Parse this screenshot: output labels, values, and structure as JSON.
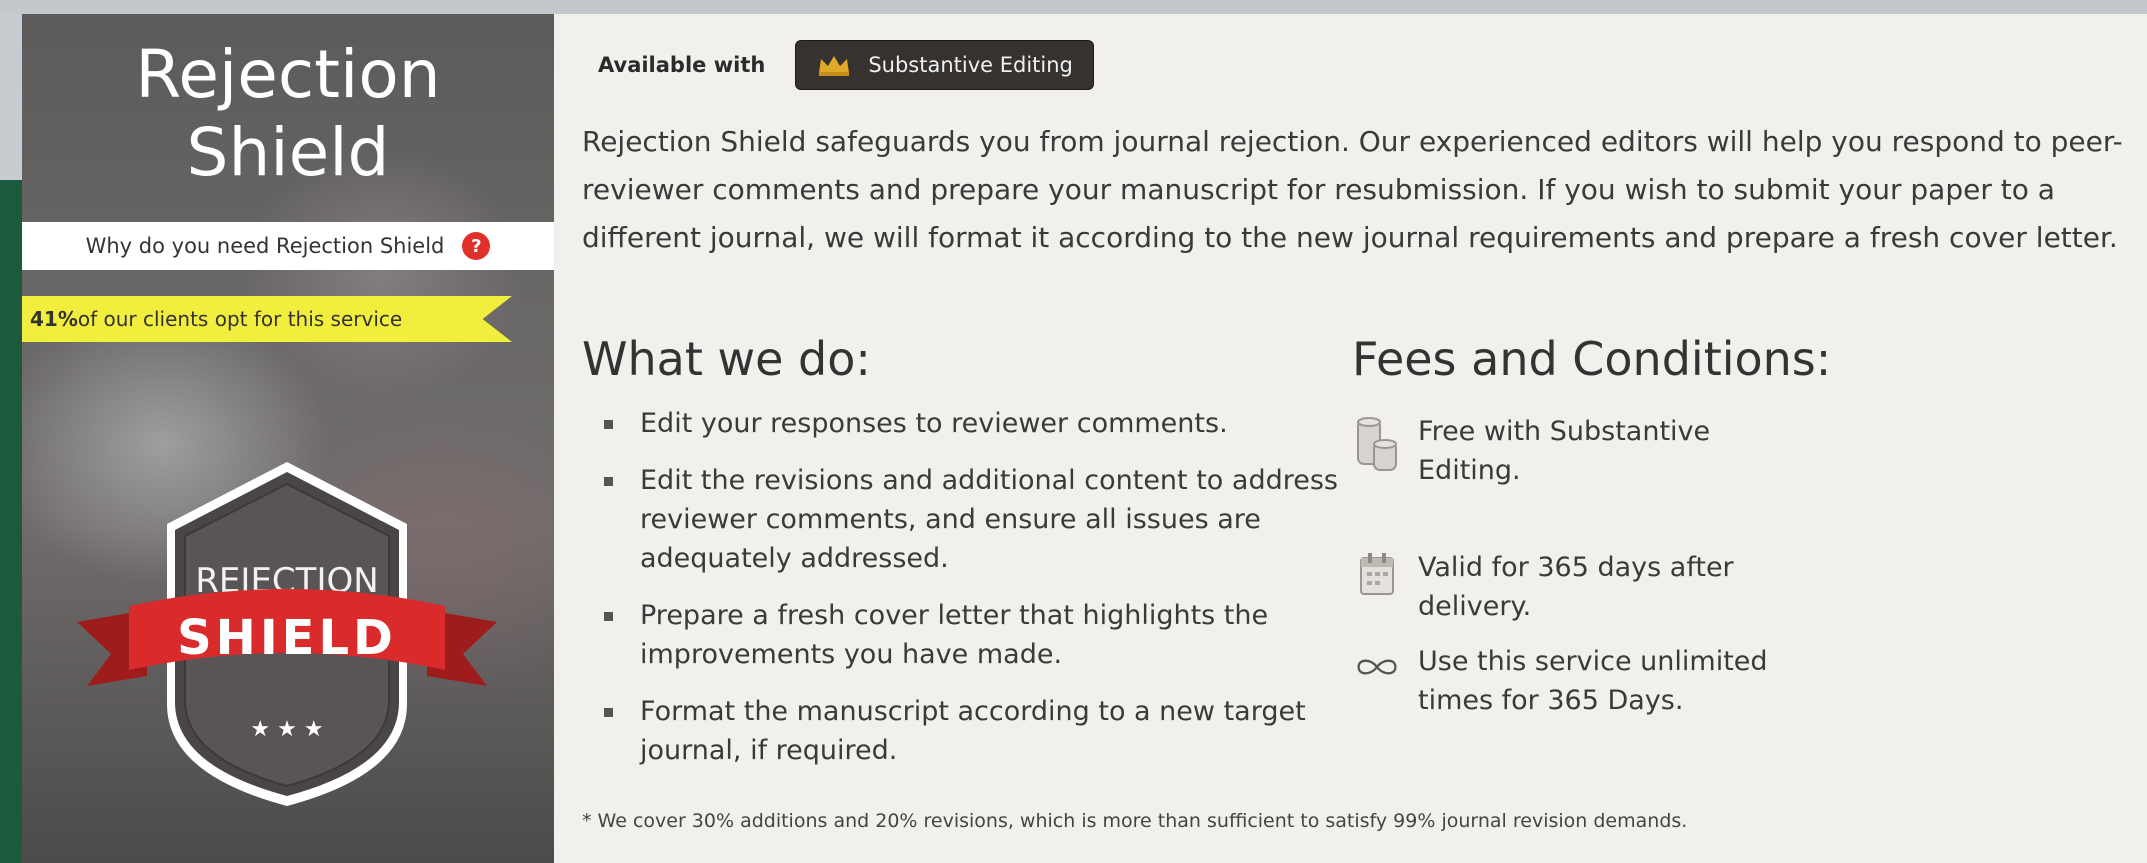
{
  "left_panel": {
    "title_line1": "Rejection",
    "title_line2": "Shield",
    "why_link": "Why do you need Rejection Shield",
    "why_icon": "question-icon",
    "ribbon_percent": "41%",
    "ribbon_text": " of our clients opt for this service",
    "badge": {
      "line1": "REJECTION",
      "line2": "SHIELD"
    }
  },
  "header": {
    "available_label": "Available with",
    "crown_icon": "crown-icon",
    "plan_label": "Substantive Editing"
  },
  "intro": "Rejection Shield safeguards you from journal rejection. Our experienced editors will help you respond to peer-reviewer comments and prepare your manuscript for resubmission. If you wish to submit your paper to a different journal, we will format it according to the new journal requirements and prepare a fresh cover letter.",
  "what_we_do": {
    "heading": "What we do:",
    "items": [
      "Edit your responses to reviewer comments.",
      "Edit the revisions and additional content to address reviewer comments, and ensure all issues are adequately addressed.",
      "Prepare a fresh cover letter that highlights the improvements you have made.",
      "Format the manuscript according to a new target journal, if required."
    ]
  },
  "fees": {
    "heading": "Fees and Conditions:",
    "items": [
      {
        "icon": "coins-icon",
        "text": "Free with Substantive Editing."
      },
      {
        "icon": "calendar-icon",
        "text": "Valid for 365 days after delivery."
      },
      {
        "icon": "infinity-icon",
        "text": "Use this service unlimited times for 365 Days."
      }
    ]
  },
  "footnote": "* We cover 30% additions and 20% revisions, which is more than sufficient to satisfy 99% journal revision demands.",
  "colors": {
    "green_bar": "#1c5a3e",
    "ribbon": "#f2ee3e",
    "badge_red": "#d92b2b",
    "pill_bg": "#353230",
    "crown_gold": "#e0a92a"
  }
}
